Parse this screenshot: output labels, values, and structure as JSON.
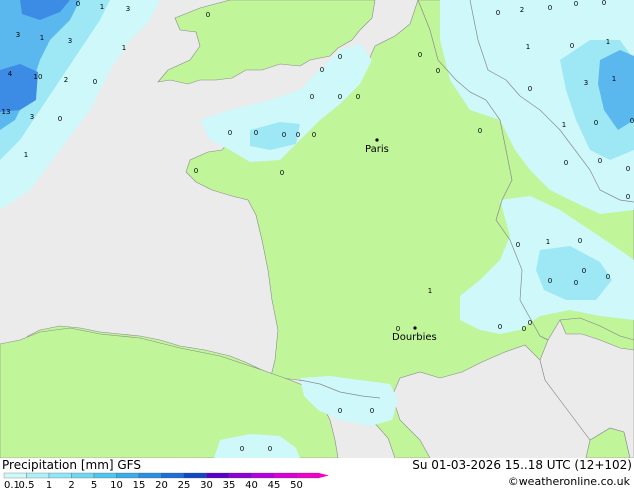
{
  "header": {
    "title": "Precipitation [mm] GFS",
    "datetime": "Su 01-03-2026 15..18 UTC (12+102)",
    "credit": "©weatheronline.co.uk"
  },
  "colors": {
    "land": "#c0f59a",
    "sea": "#ebebeb",
    "precip_light": "#cef8fa",
    "precip_mid": "#9ee8f6",
    "precip_heavy": "#5ab8ee",
    "precip_strong": "#3c8ce6",
    "border": "#8a8a8a"
  },
  "legend": {
    "labels": [
      "0.1",
      "0.5",
      "1",
      "2",
      "5",
      "10",
      "15",
      "20",
      "25",
      "30",
      "35",
      "40",
      "45",
      "50"
    ],
    "swatches": [
      "#cef8fa",
      "#aef0f8",
      "#8ee6f6",
      "#6ed8f2",
      "#4ec6ee",
      "#3aacea",
      "#2a8ee2",
      "#1c6ed6",
      "#1046c0",
      "#5a00c8",
      "#8a00d8",
      "#b400e0",
      "#d800d8",
      "#f000c8"
    ]
  },
  "cities": [
    {
      "name": "Paris"
    },
    {
      "name": "Dourbies"
    }
  ],
  "precip_labels": [
    "0",
    "1",
    "3",
    "3",
    "3",
    "1",
    "4",
    "10",
    "2",
    "0",
    "13",
    "3",
    "0",
    "1",
    "0",
    "1",
    "0",
    "0",
    "0",
    "0",
    "0",
    "0",
    "0",
    "0",
    "0",
    "0",
    "0",
    "0",
    "0",
    "0",
    "0",
    "0",
    "1",
    "2",
    "0",
    "0",
    "3",
    "1",
    "1",
    "0",
    "1",
    "0",
    "0",
    "0",
    "0",
    "0",
    "0",
    "0",
    "0",
    "1",
    "0",
    "0",
    "0",
    "0",
    "0",
    "0",
    "0",
    "0",
    "1",
    "0",
    "0",
    "0",
    "0",
    "0",
    "0"
  ]
}
